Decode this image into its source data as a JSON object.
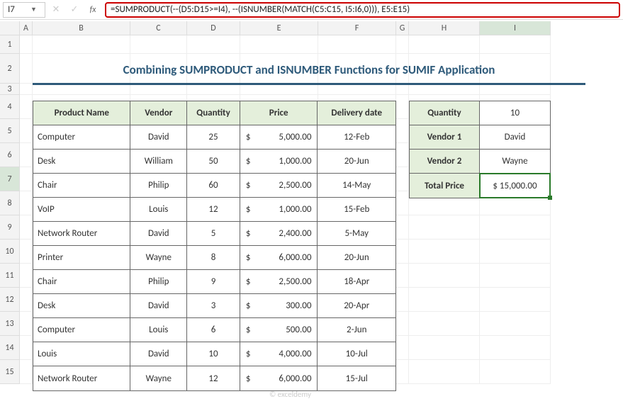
{
  "namebox": "I7",
  "formula": "=SUMPRODUCT(--(D5:D15>=I4), --(ISNUMBER(MATCH(C5:C15, I5:I6,0))), E5:E15)",
  "title": "Combining SUMPRODUCT and ISNUMBER Functions for SUMIF Application",
  "cols": [
    "A",
    "B",
    "C",
    "D",
    "E",
    "F",
    "G",
    "H",
    "I"
  ],
  "rownums": [
    "1",
    "2",
    "3",
    "4",
    "5",
    "6",
    "7",
    "8",
    "9",
    "10",
    "11",
    "12",
    "13",
    "14",
    "15"
  ],
  "headers": {
    "b": "Product Name",
    "c": "Vendor",
    "d": "Quantity",
    "e": "Price",
    "f": "Delivery date"
  },
  "rows": [
    {
      "b": "Computer",
      "c": "David",
      "d": "25",
      "e": "5,000.00",
      "f": "12-Feb"
    },
    {
      "b": "Desk",
      "c": "William",
      "d": "50",
      "e": "1,000.00",
      "f": "20-Jun"
    },
    {
      "b": "Chair",
      "c": "Philip",
      "d": "60",
      "e": "2,500.00",
      "f": "14-May"
    },
    {
      "b": "VoIP",
      "c": "Louis",
      "d": "12",
      "e": "1,000.00",
      "f": "15-Feb"
    },
    {
      "b": "Network Router",
      "c": "David",
      "d": "5",
      "e": "2,400.00",
      "f": "5-May"
    },
    {
      "b": "Printer",
      "c": "Wayne",
      "d": "8",
      "e": "6,000.00",
      "f": "20-Jun"
    },
    {
      "b": "Chair",
      "c": "Philip",
      "d": "9",
      "e": "2,500.00",
      "f": "18-Apr"
    },
    {
      "b": "Desk",
      "c": "David",
      "d": "3",
      "e": "300.00",
      "f": "20-Apr"
    },
    {
      "b": "Computer",
      "c": "Louis",
      "d": "6",
      "e": "500.00",
      "f": "2-Jun"
    },
    {
      "b": "Louis",
      "c": "David",
      "d": "10",
      "e": "4,000.00",
      "f": "10-Jul"
    },
    {
      "b": "Network Router",
      "c": "Wayne",
      "d": "12",
      "e": "6,000.00",
      "f": "15-Jul"
    }
  ],
  "side": [
    {
      "h": "Quantity",
      "v": "10"
    },
    {
      "h": "Vendor 1",
      "v": "David"
    },
    {
      "h": "Vendor 2",
      "v": "Wayne"
    },
    {
      "h": "Total Price",
      "v": "$ 15,000.00"
    }
  ],
  "currency": "$",
  "watermark": "© exceldemy"
}
